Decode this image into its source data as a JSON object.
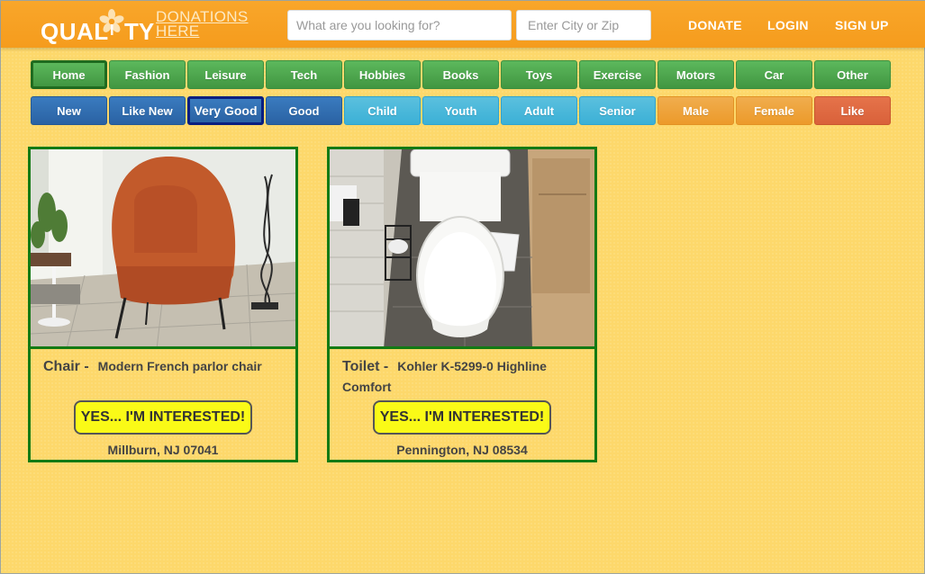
{
  "header": {
    "logo_quality": "QUAL",
    "logo_ty": "TY",
    "logo_donations_line1": "DONATIONS",
    "logo_donations_line2": "HERE",
    "search_placeholder": "What are you looking for?",
    "zip_placeholder": "Enter City or Zip",
    "nav": [
      "DONATE",
      "LOGIN",
      "SIGN UP"
    ]
  },
  "categories": [
    "Home",
    "Fashion",
    "Leisure",
    "Tech",
    "Hobbies",
    "Books",
    "Toys",
    "Exercise",
    "Motors",
    "Car",
    "Other"
  ],
  "conditions": [
    "New",
    "Like New",
    "Very Good",
    "Good"
  ],
  "ages": [
    "Child",
    "Youth",
    "Adult",
    "Senior"
  ],
  "genders": [
    "Male",
    "Female"
  ],
  "extra": [
    "Like"
  ],
  "selected": {
    "category": "Home",
    "condition": "Very Good"
  },
  "listings": [
    {
      "item": "Chair -",
      "description": "Modern French parlor chair",
      "button_label": "YES... I'M INTERESTED!",
      "location": "Millburn, NJ 07041"
    },
    {
      "item": "Toilet -",
      "description": "Kohler K-5299-0 Highline Comfort",
      "button_label": "YES... I'M INTERESTED!",
      "location": "Pennington, NJ 08534"
    }
  ],
  "colors": {
    "background": "#fdd86b",
    "topbar": "#f7a023",
    "card_border": "#137a14",
    "interest_button": "#fafa17"
  }
}
